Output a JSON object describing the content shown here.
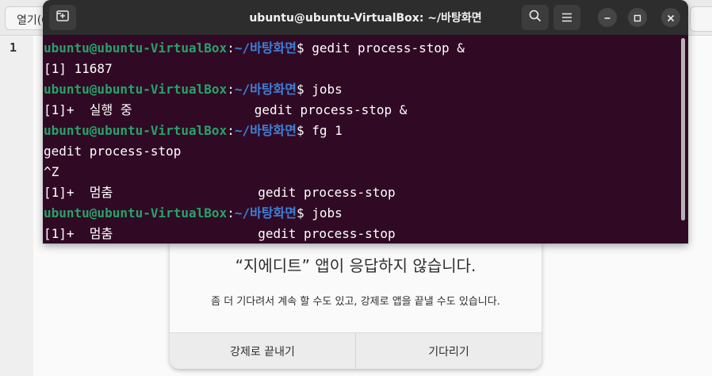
{
  "gedit": {
    "open_button_label": "열기(O)",
    "line_number": "1"
  },
  "terminal": {
    "title": "ubuntu@ubuntu-VirtualBox: ~/바탕화면",
    "lines": [
      {
        "type": "prompt",
        "user": "ubuntu@ubuntu-VirtualBox",
        "sep": ":",
        "path": "~/바탕화면",
        "dollar": "$ ",
        "cmd": "gedit process-stop &"
      },
      {
        "type": "output",
        "text": "[1] 11687"
      },
      {
        "type": "prompt",
        "user": "ubuntu@ubuntu-VirtualBox",
        "sep": ":",
        "path": "~/바탕화면",
        "dollar": "$ ",
        "cmd": "jobs"
      },
      {
        "type": "output",
        "text": "[1]+  실행 중                gedit process-stop &"
      },
      {
        "type": "prompt",
        "user": "ubuntu@ubuntu-VirtualBox",
        "sep": ":",
        "path": "~/바탕화면",
        "dollar": "$ ",
        "cmd": "fg 1"
      },
      {
        "type": "output",
        "text": "gedit process-stop"
      },
      {
        "type": "output",
        "text": "^Z"
      },
      {
        "type": "output",
        "text": "[1]+  멈춤                   gedit process-stop"
      },
      {
        "type": "prompt",
        "user": "ubuntu@ubuntu-VirtualBox",
        "sep": ":",
        "path": "~/바탕화면",
        "dollar": "$ ",
        "cmd": "jobs"
      },
      {
        "type": "output",
        "text": "[1]+  멈춤                   gedit process-stop"
      }
    ]
  },
  "dialog": {
    "title": "“지에디트” 앱이 응답하지 않습니다.",
    "body": "좀 더 기다려서 계속 할 수도 있고, 강제로 앱을 끝낼 수도 있습니다.",
    "force_quit_label": "강제로 끝내기",
    "wait_label": "기다리기"
  },
  "colors": {
    "terminal_bg": "#300a24",
    "prompt_user": "#26a269",
    "prompt_path": "#3f7fd6"
  },
  "icons": [
    "new-tab-icon",
    "search-icon",
    "hamburger-menu-icon",
    "minimize-icon",
    "maximize-icon",
    "close-icon"
  ]
}
